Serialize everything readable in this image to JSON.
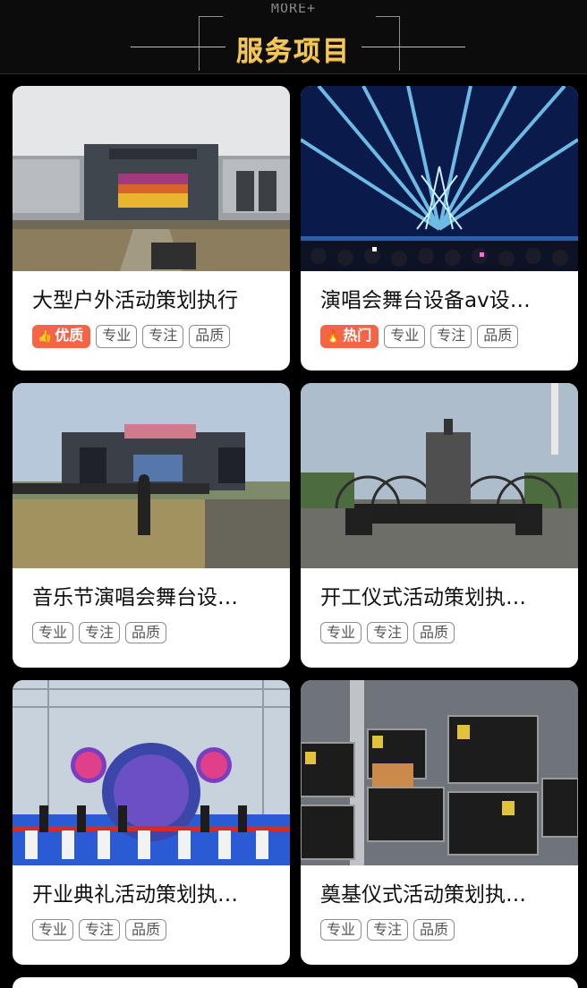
{
  "header": {
    "more_text": "MORE+",
    "title": "服务项目"
  },
  "cards": [
    {
      "title": "大型户外活动策划执行",
      "badge": {
        "label": "优质",
        "icon": "thumbs-up-icon",
        "color": "#f26548"
      },
      "tags": [
        "专业",
        "专注",
        "品质"
      ],
      "image": "outdoor concert stage with truss towers and LED screen"
    },
    {
      "title": "演唱会舞台设备av设…",
      "badge": {
        "label": "热门",
        "icon": "fire-icon",
        "color": "#f26548"
      },
      "tags": [
        "专业",
        "专注",
        "品质"
      ],
      "image": "blue laser light show over crowd"
    },
    {
      "title": "音乐节演唱会舞台设…",
      "tags": [
        "专业",
        "专注",
        "品质"
      ],
      "image": "music festival stage Love Stage on grass field"
    },
    {
      "title": "开工仪式活动策划执…",
      "tags": [
        "专业",
        "专注",
        "品质"
      ],
      "image": "stage with arched truss structure under construction"
    },
    {
      "title": "开业典礼活动策划执…",
      "tags": [
        "专业",
        "专注",
        "品质"
      ],
      "image": "opening ceremony stage with ribbon cutting"
    },
    {
      "title": "奠基仪式活动策划执…",
      "tags": [
        "专业",
        "专注",
        "品质"
      ],
      "image": "stacked black equipment road cases in warehouse"
    }
  ]
}
